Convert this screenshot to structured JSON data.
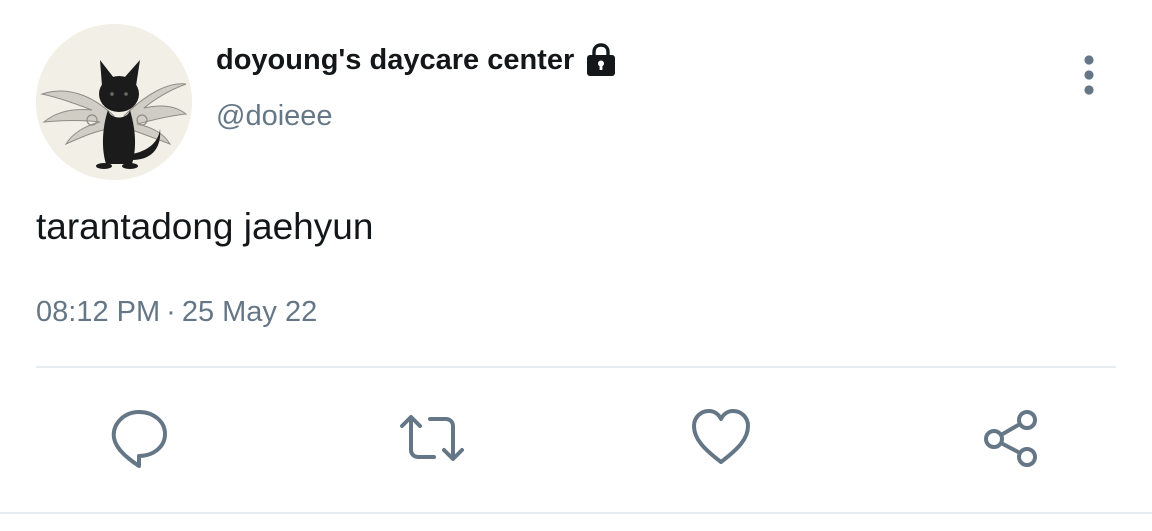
{
  "tweet": {
    "display_name": "doyoung's daycare center",
    "handle": "@doieee",
    "text": "tarantadong jaehyun",
    "time": "08:12 PM",
    "separator": "·",
    "date": "25 May 22",
    "protected": true
  },
  "icons": {
    "lock": "lock-icon",
    "more": "more-vertical-icon",
    "reply": "reply-icon",
    "retweet": "retweet-icon",
    "like": "heart-icon",
    "share": "share-icon"
  },
  "colors": {
    "text_primary": "#14171a",
    "text_secondary": "#657786",
    "divider": "#e6ecf0"
  }
}
